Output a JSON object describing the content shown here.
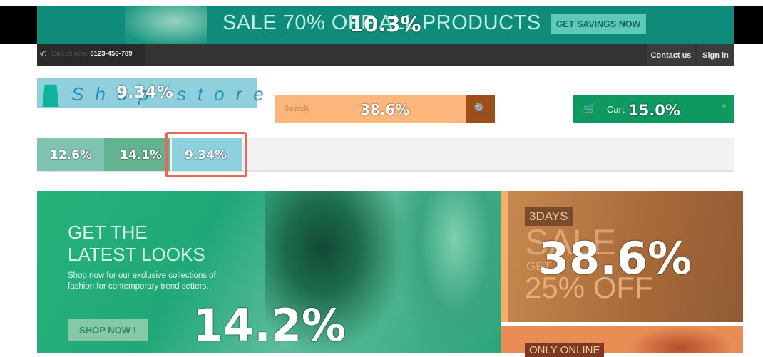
{
  "banner": {
    "text": "SALE 70% OFF ALL PRODUCTS",
    "button_label": "GET SAVINGS NOW",
    "overlay_percent": "10.3%"
  },
  "topbar": {
    "phone_label": "Call us now: ",
    "phone_number": "0123-456-789",
    "links": [
      "Contact us",
      "Sign in"
    ]
  },
  "logo": {
    "text": "Shop store",
    "overlay_percent": "9.34%"
  },
  "search": {
    "placeholder": "Search",
    "overlay_percent": "38.6%"
  },
  "cart": {
    "label": "Cart",
    "overlay_percent": "15.0%"
  },
  "nav": {
    "tabs": [
      {
        "overlay_percent": "12.6%"
      },
      {
        "overlay_percent": "14.1%"
      },
      {
        "overlay_percent": "9.34%"
      }
    ]
  },
  "hero": {
    "title_line1": "GET THE",
    "title_line2": "LATEST LOOKS",
    "subtitle": "Shop now for our exclusive collections of fashion for contemporary trend setters.",
    "button_label": "SHOP NOW !",
    "overlay_percent": "14.2%"
  },
  "promo": {
    "badge": "3DAYS",
    "sale": "SALE",
    "get": "GET",
    "off": "25% OFF",
    "overlay_percent": "38.6%",
    "badge2": "ONLY ONLINE"
  },
  "colors": {
    "banner": "#0e8c79",
    "cart": "#0f9860",
    "search": "#fbb77b",
    "highlight": "#e5695b"
  }
}
